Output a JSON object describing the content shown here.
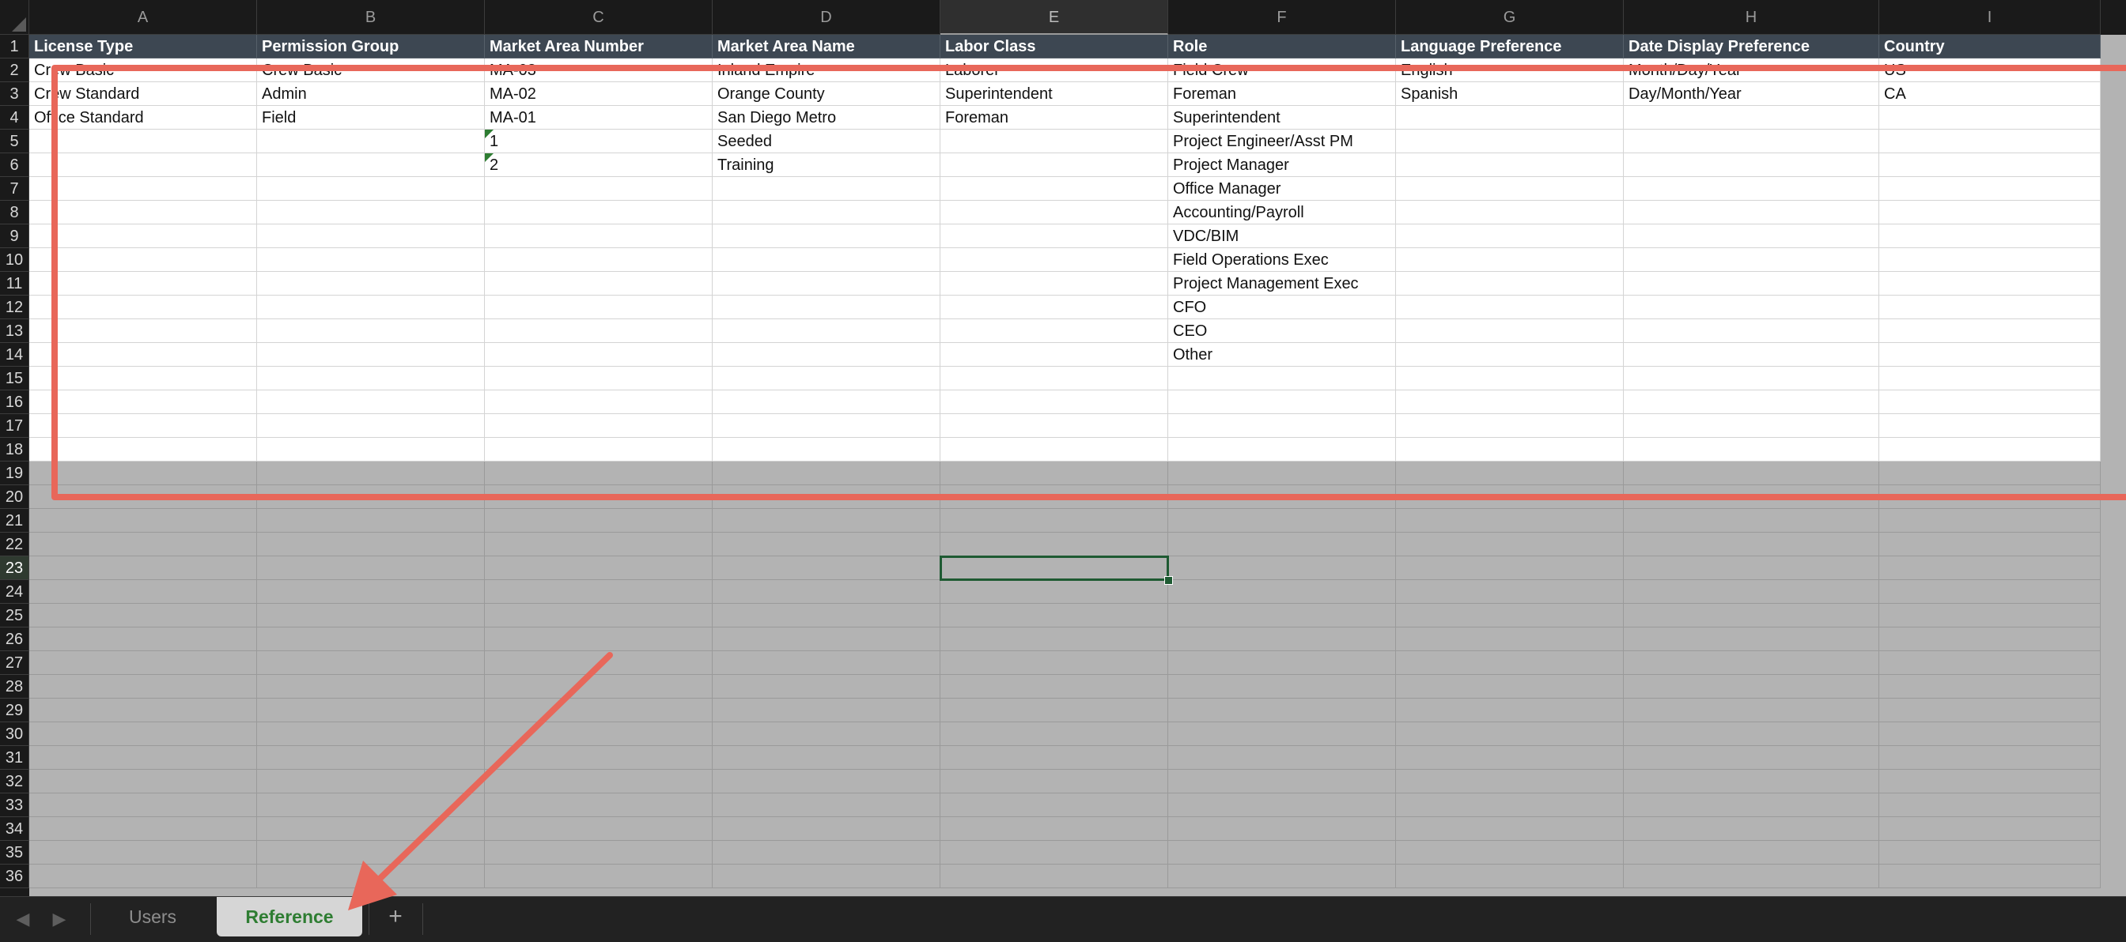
{
  "columns": [
    "A",
    "B",
    "C",
    "D",
    "E",
    "F",
    "G",
    "H",
    "I"
  ],
  "active_column": "E",
  "active_row": "23",
  "rows": [
    "1",
    "2",
    "3",
    "4",
    "5",
    "6",
    "7",
    "8",
    "9",
    "10",
    "11",
    "12",
    "13",
    "14",
    "15",
    "16",
    "17",
    "18",
    "19",
    "20",
    "21",
    "22",
    "23",
    "24",
    "25",
    "26",
    "27",
    "28",
    "29",
    "30",
    "31",
    "32",
    "33",
    "34",
    "35",
    "36"
  ],
  "headers": [
    "License Type",
    "Permission Group",
    "Market Area Number",
    "Market Area Name",
    "Labor Class",
    "Role",
    "Language Preference",
    "Date Display Preference",
    "Country"
  ],
  "data_rows": [
    [
      "Crew Basic",
      "Crew Basic",
      "MA-03",
      "Inland Empire",
      "Laborer",
      "Field Crew",
      "English",
      "Month/Day/Year",
      "US"
    ],
    [
      "Crew Standard",
      "Admin",
      "MA-02",
      "Orange County",
      "Superintendent",
      "Foreman",
      "Spanish",
      "Day/Month/Year",
      "CA"
    ],
    [
      "Office Standard",
      "Field",
      "MA-01",
      "San Diego Metro",
      "Foreman",
      "Superintendent",
      "",
      "",
      ""
    ],
    [
      "",
      "",
      "1",
      "Seeded",
      "",
      "Project Engineer/Asst PM",
      "",
      "",
      ""
    ],
    [
      "",
      "",
      "2",
      "Training",
      "",
      "Project Manager",
      "",
      "",
      ""
    ],
    [
      "",
      "",
      "",
      "",
      "",
      "Office Manager",
      "",
      "",
      ""
    ],
    [
      "",
      "",
      "",
      "",
      "",
      "Accounting/Payroll",
      "",
      "",
      ""
    ],
    [
      "",
      "",
      "",
      "",
      "",
      "VDC/BIM",
      "",
      "",
      ""
    ],
    [
      "",
      "",
      "",
      "",
      "",
      "Field Operations Exec",
      "",
      "",
      ""
    ],
    [
      "",
      "",
      "",
      "",
      "",
      "Project Management Exec",
      "",
      "",
      ""
    ],
    [
      "",
      "",
      "",
      "",
      "",
      "CFO",
      "",
      "",
      ""
    ],
    [
      "",
      "",
      "",
      "",
      "",
      "CEO",
      "",
      "",
      ""
    ],
    [
      "",
      "",
      "",
      "",
      "",
      "Other",
      "",
      "",
      ""
    ]
  ],
  "number_as_text_cells": [
    "C5",
    "C6"
  ],
  "tabs": {
    "items": [
      {
        "label": "Users",
        "active": false
      },
      {
        "label": "Reference",
        "active": true
      }
    ],
    "add_icon": "+",
    "prev_icon": "◀",
    "next_icon": "▶"
  },
  "annotation": {
    "highlight_color": "#e8675a",
    "arrow_color": "#e8675a"
  }
}
